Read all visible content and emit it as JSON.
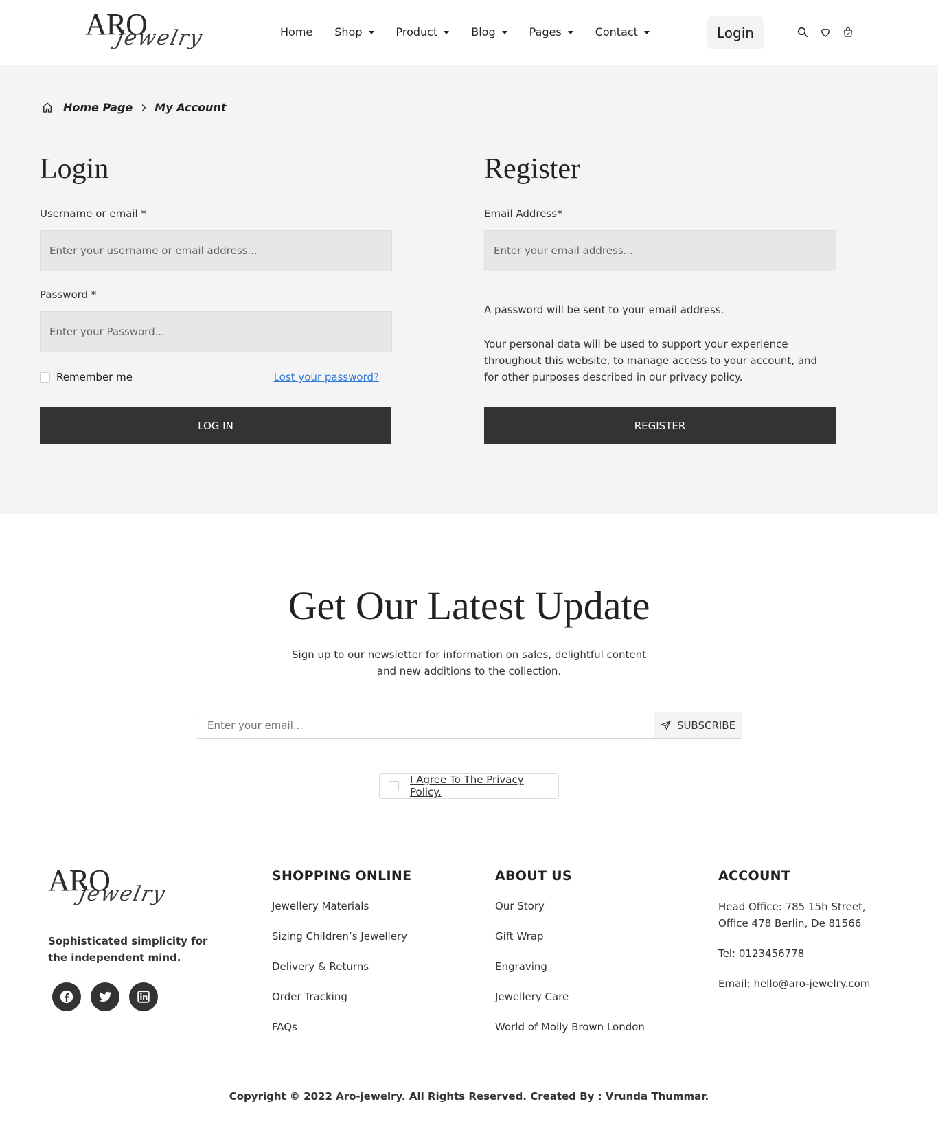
{
  "brand": {
    "logo_main": "ARO",
    "logo_script": "jewelry"
  },
  "header": {
    "nav": [
      {
        "label": "Home",
        "dropdown": false
      },
      {
        "label": "Shop",
        "dropdown": true
      },
      {
        "label": "Product",
        "dropdown": true
      },
      {
        "label": "Blog",
        "dropdown": true
      },
      {
        "label": "Pages",
        "dropdown": true
      },
      {
        "label": "Contact",
        "dropdown": true
      }
    ],
    "login_label": "Login",
    "icons": [
      "search-icon",
      "heart-icon",
      "cart-icon"
    ]
  },
  "breadcrumb": {
    "home": "Home Page",
    "current": "My Account"
  },
  "login": {
    "title": "Login",
    "username_label": "Username or email *",
    "username_placeholder": "Enter your username or email address...",
    "password_label": "Password *",
    "password_placeholder": "Enter your Password...",
    "remember_label": "Remember me",
    "lost_password": "Lost your password?",
    "submit_label": "LOG IN"
  },
  "register": {
    "title": "Register",
    "email_label": "Email Address*",
    "email_placeholder": "Enter your email address...",
    "note_password": "A password will be sent to your email address.",
    "note_privacy": "Your personal data will be used to support your experience throughout this website, to manage access to your account, and for other purposes described in our privacy policy.",
    "submit_label": "REGISTER"
  },
  "newsletter": {
    "title": "Get Our Latest Update",
    "subtitle_line1": "Sign up to our newsletter for information on sales, delightful content",
    "subtitle_line2": "and new additions to the collection.",
    "email_placeholder": "Enter your email...",
    "subscribe_label": "SUBSCRIBE",
    "privacy_label": "I Agree To The Privacy Policy."
  },
  "footer": {
    "tagline": "Sophisticated simplicity for the independent mind.",
    "socials": [
      "facebook-icon",
      "twitter-icon",
      "linkedin-icon"
    ],
    "shopping": {
      "title": "SHOPPING ONLINE",
      "links": [
        "Jewellery Materials",
        "Sizing Children’s Jewellery",
        "Delivery & Returns",
        "Order Tracking",
        "FAQs"
      ]
    },
    "about": {
      "title": "ABOUT US",
      "links": [
        "Our Story",
        "Gift Wrap",
        "Engraving",
        "Jewellery Care",
        "World of Molly Brown London"
      ]
    },
    "account": {
      "title": "ACCOUNT",
      "address": "Head Office: 785 15h Street, Office 478 Berlin, De 81566",
      "tel": "Tel: 0123456778",
      "email": "Email: hello@aro-jewelry.com"
    },
    "copyright": "Copyright © 2022 Aro-jewelry. All Rights Reserved. Created By : Vrunda Thummar."
  },
  "colors": {
    "dark_button": "#333333",
    "link_blue": "#2f7bd8",
    "section_bg": "#f4f4f4",
    "input_bg": "#e8e6e6"
  }
}
